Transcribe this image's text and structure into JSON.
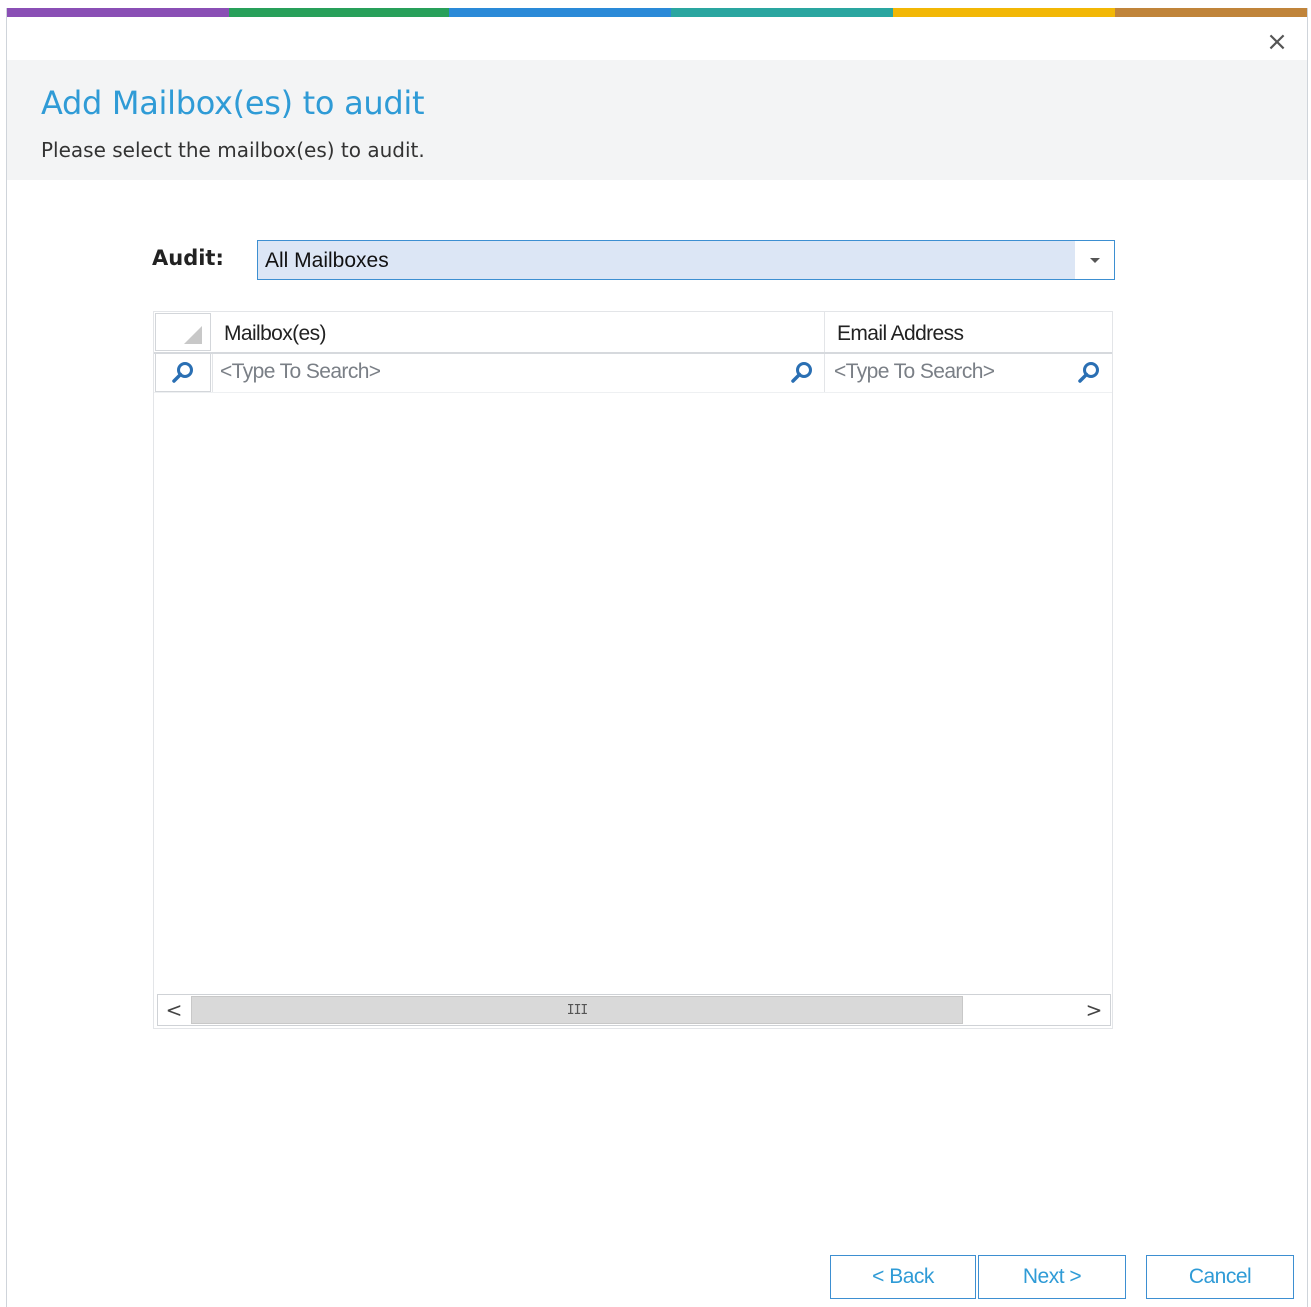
{
  "window": {
    "close_label": "×",
    "accent_stripes": [
      "#8a4fb5",
      "#28a05a",
      "#2a8ad8",
      "#2aa6a0",
      "#f2b705",
      "#c0843a"
    ]
  },
  "header": {
    "title": "Add Mailbox(es) to audit",
    "subtitle": "Please select the mailbox(es) to audit."
  },
  "audit": {
    "label": "Audit:",
    "selected": "All Mailboxes"
  },
  "grid": {
    "columns": [
      {
        "label": "Mailbox(es)"
      },
      {
        "label": "Email Address"
      }
    ],
    "filter_placeholder": "<Type To Search>",
    "rows": [],
    "scrollbar": {
      "left": "<",
      "right": ">",
      "grip": "III"
    }
  },
  "footer": {
    "back_label": "< Back",
    "next_label": "Next >",
    "cancel_label": "Cancel"
  }
}
